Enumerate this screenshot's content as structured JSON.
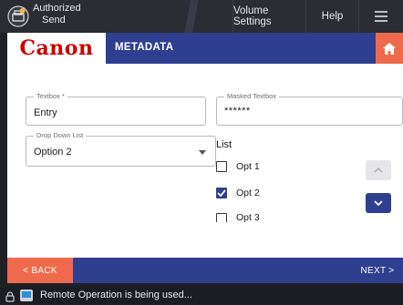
{
  "topbar": {
    "auth_line1": "Authorized",
    "auth_line2": "Send",
    "volume_settings": "Volume Settings",
    "help": "Help",
    "icons": {
      "auth": "authorized-send-icon",
      "menu": "hamburger-menu-icon"
    }
  },
  "header": {
    "logo": "Canon",
    "title": "METADATA",
    "home_icon": "home-icon"
  },
  "form": {
    "textbox": {
      "label": "Textbox *",
      "value": "Entry"
    },
    "masked": {
      "label": "Masked Textbox",
      "value": "******"
    },
    "dropdown": {
      "label": "Drop Down List",
      "value": "Option 2"
    },
    "list": {
      "title": "List",
      "options": [
        {
          "label": "Opt 1",
          "checked": false
        },
        {
          "label": "Opt 2",
          "checked": true
        },
        {
          "label": "Opt 3",
          "checked": false
        }
      ]
    }
  },
  "footer": {
    "back": "< BACK",
    "next": "NEXT >"
  },
  "status": {
    "text": "Remote Operation is being used..."
  },
  "colors": {
    "brand_blue": "#2f3f8f",
    "accent_orange": "#ef6a4c",
    "canon_red": "#cc0000",
    "dark_bg": "#2b2c34"
  }
}
